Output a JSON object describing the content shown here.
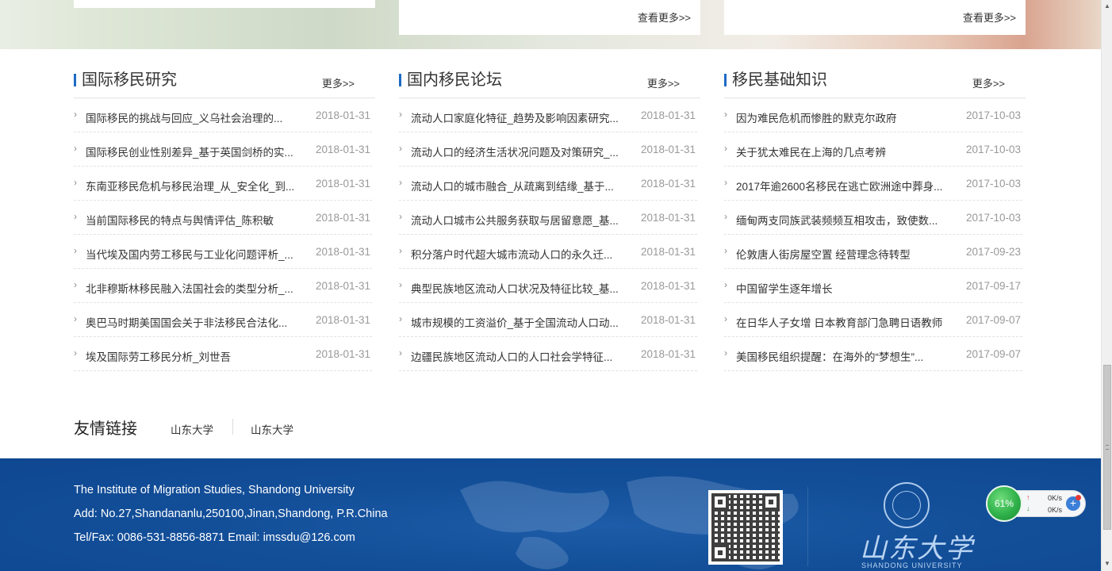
{
  "top_section": {
    "more_label_2": "查看更多>>",
    "more_label_3": "查看更多>>"
  },
  "columns": [
    {
      "title": "国际移民研究",
      "more": "更多>>",
      "items": [
        {
          "title": "国际移民的挑战与回应_义乌社会治理的...",
          "date": "2018-01-31"
        },
        {
          "title": "国际移民创业性别差异_基于英国剑桥的实...",
          "date": "2018-01-31"
        },
        {
          "title": "东南亚移民危机与移民治理_从_安全化_到...",
          "date": "2018-01-31"
        },
        {
          "title": "当前国际移民的特点与舆情评估_陈积敏",
          "date": "2018-01-31"
        },
        {
          "title": "当代埃及国内劳工移民与工业化问题评析_...",
          "date": "2018-01-31"
        },
        {
          "title": "北非穆斯林移民融入法国社会的类型分析_...",
          "date": "2018-01-31"
        },
        {
          "title": "奥巴马时期美国国会关于非法移民合法化...",
          "date": "2018-01-31"
        },
        {
          "title": "埃及国际劳工移民分析_刘世吾",
          "date": "2018-01-31"
        }
      ]
    },
    {
      "title": "国内移民论坛",
      "more": "更多>>",
      "items": [
        {
          "title": "流动人口家庭化特征_趋势及影响因素研究...",
          "date": "2018-01-31"
        },
        {
          "title": "流动人口的经济生活状况问题及对策研究_...",
          "date": "2018-01-31"
        },
        {
          "title": "流动人口的城市融合_从疏离到结缘_基于...",
          "date": "2018-01-31"
        },
        {
          "title": "流动人口城市公共服务获取与居留意愿_基...",
          "date": "2018-01-31"
        },
        {
          "title": "积分落户时代超大城市流动人口的永久迁...",
          "date": "2018-01-31"
        },
        {
          "title": "典型民族地区流动人口状况及特征比较_基...",
          "date": "2018-01-31"
        },
        {
          "title": "城市规模的工资溢价_基于全国流动人口动...",
          "date": "2018-01-31"
        },
        {
          "title": "边疆民族地区流动人口的人口社会学特征...",
          "date": "2018-01-31"
        }
      ]
    },
    {
      "title": "移民基础知识",
      "more": "更多>>",
      "items": [
        {
          "title": "因为难民危机而惨胜的默克尔政府",
          "date": "2017-10-03"
        },
        {
          "title": "关于犹太难民在上海的几点考辨",
          "date": "2017-10-03"
        },
        {
          "title": "2017年逾2600名移民在逃亡欧洲途中葬身...",
          "date": "2017-10-03"
        },
        {
          "title": "缅甸两支同族武装频频互相攻击，致使数...",
          "date": "2017-10-03"
        },
        {
          "title": "伦敦唐人街房屋空置 经营理念待转型",
          "date": "2017-09-23"
        },
        {
          "title": "中国留学生逐年增长",
          "date": "2017-09-17"
        },
        {
          "title": "在日华人子女增 日本教育部门急聘日语教师",
          "date": "2017-09-07"
        },
        {
          "title": "美国移民组织提醒：在海外的“梦想生”...",
          "date": "2017-09-07"
        }
      ]
    }
  ],
  "friend_links": {
    "title": "友情链接",
    "links": [
      "山东大学",
      "山东大学"
    ]
  },
  "footer": {
    "line1": "The Institute of Migration Studies, Shandong University",
    "line2": "Add: No.27,Shandananlu,250100,Jinan,Shandong, P.R.China",
    "line3": "Tel/Fax: 0086-531-8856-8871 Email: imssdu@126.com",
    "sdu_name": "山东大学",
    "sdu_en": "SHANDONG UNIVERSITY"
  },
  "speed_widget": {
    "percent": "61%",
    "upload": "0K/s",
    "download": "0K/s"
  },
  "colors": {
    "accent": "#1e6bc4",
    "footer_bg": "#134f99",
    "date_text": "#999999"
  },
  "icons": {
    "item_marker": "chevron-right-icon",
    "widget_add": "plus-icon"
  }
}
